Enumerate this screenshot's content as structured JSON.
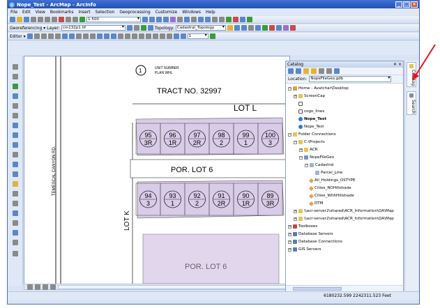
{
  "window": {
    "title": "Nope_Test - ArcMap - ArcInfo"
  },
  "menu": [
    "File",
    "Edit",
    "View",
    "Bookmarks",
    "Insert",
    "Selection",
    "Geoprocessing",
    "Customize",
    "Windows",
    "Help"
  ],
  "toolbar1": {
    "scale": "1:500"
  },
  "toolbar2": {
    "georef_label": "Georeferencing ▾",
    "layer_label": "Layer:",
    "layer_value": "cm132p1.tif",
    "topology_label": "Topology:",
    "topology_value": "Cadastral_Topology"
  },
  "toolbar3": {
    "editor_label": "Editor ▾",
    "value_box": "1"
  },
  "map": {
    "header_line1": "UNIT NUMBER",
    "header_line2": "PLAN WHL",
    "tract": "TRACT NO. 32997",
    "lot_top": "LOT L",
    "street": "TEMESCAL CANYON RD.",
    "por_lot_mid": "POR. LOT 6",
    "lot_left": "LOT K",
    "por_lot_bottom": "POR. LOT 6",
    "top_row": [
      {
        "num": "95",
        "sub": "3R"
      },
      {
        "num": "96",
        "sub": "1R"
      },
      {
        "num": "97",
        "sub": "2R"
      },
      {
        "num": "98",
        "sub": "2"
      },
      {
        "num": "99",
        "sub": "1"
      },
      {
        "num": "100",
        "sub": "3"
      }
    ],
    "bottom_row": [
      {
        "num": "94",
        "sub": "3"
      },
      {
        "num": "93",
        "sub": "1"
      },
      {
        "num": "92",
        "sub": "2"
      },
      {
        "num": "91",
        "sub": "2R"
      },
      {
        "num": "90",
        "sub": "1R"
      },
      {
        "num": "89",
        "sub": "3R"
      }
    ]
  },
  "catalog": {
    "title": "Catalog",
    "close": "✕ ×",
    "location_label": "Location:",
    "location_value": "NopeFileGeo.gdb",
    "tree": [
      {
        "label": "Home - Avatchar\\Desktop",
        "indent": 0,
        "exp": "−",
        "icon": "home"
      },
      {
        "label": "ScreenCap",
        "indent": 1,
        "exp": "+",
        "icon": "folder"
      },
      {
        "label": "",
        "indent": 1,
        "exp": "",
        "icon": "file"
      },
      {
        "label": "cogo_lines",
        "indent": 1,
        "exp": "",
        "icon": "file"
      },
      {
        "label": "Nope_Test",
        "indent": 1,
        "exp": "",
        "icon": "map",
        "bold": true
      },
      {
        "label": "Nope_Test",
        "indent": 1,
        "exp": "",
        "icon": "map"
      },
      {
        "label": "Folder Connections",
        "indent": 0,
        "exp": "−",
        "icon": "folder"
      },
      {
        "label": "C:\\Projects",
        "indent": 1,
        "exp": "−",
        "icon": "folder"
      },
      {
        "label": "ACR",
        "indent": 2,
        "exp": "+",
        "icon": "folder"
      },
      {
        "label": "NopeFileGeo",
        "indent": 2,
        "exp": "−",
        "icon": "gdb"
      },
      {
        "label": "Cadastral",
        "indent": 3,
        "exp": "−",
        "icon": "fc"
      },
      {
        "label": "Parcel_Line",
        "indent": 4,
        "exp": "",
        "icon": "fc"
      },
      {
        "label": "All_Holdings_OSTYPE",
        "indent": 3,
        "exp": "",
        "icon": "poly"
      },
      {
        "label": "Cities_NOHillshade",
        "indent": 3,
        "exp": "",
        "icon": "poly"
      },
      {
        "label": "Cities_WithHillshade",
        "indent": 3,
        "exp": "",
        "icon": "poly"
      },
      {
        "label": "DTM",
        "indent": 3,
        "exp": "",
        "icon": "poly"
      },
      {
        "label": "\\\\acr-server2\\shared\\ACR_Information\\QA\\Map",
        "indent": 1,
        "exp": "+",
        "icon": "folder"
      },
      {
        "label": "\\\\acr-server2\\shared\\ACR_Information\\QA\\Map",
        "indent": 1,
        "exp": "+",
        "icon": "folder"
      },
      {
        "label": "Toolboxes",
        "indent": 0,
        "exp": "+",
        "icon": "tbox"
      },
      {
        "label": "Database Servers",
        "indent": 0,
        "exp": "+",
        "icon": "db"
      },
      {
        "label": "Database Connections",
        "indent": 0,
        "exp": "+",
        "icon": "db"
      },
      {
        "label": "GIS Servers",
        "indent": 0,
        "exp": "+",
        "icon": "db"
      }
    ]
  },
  "sidetabs": {
    "catalog": "Catalog",
    "search": "Search"
  },
  "status": {
    "coords": "6180232.599  2242311.523 Feet"
  }
}
